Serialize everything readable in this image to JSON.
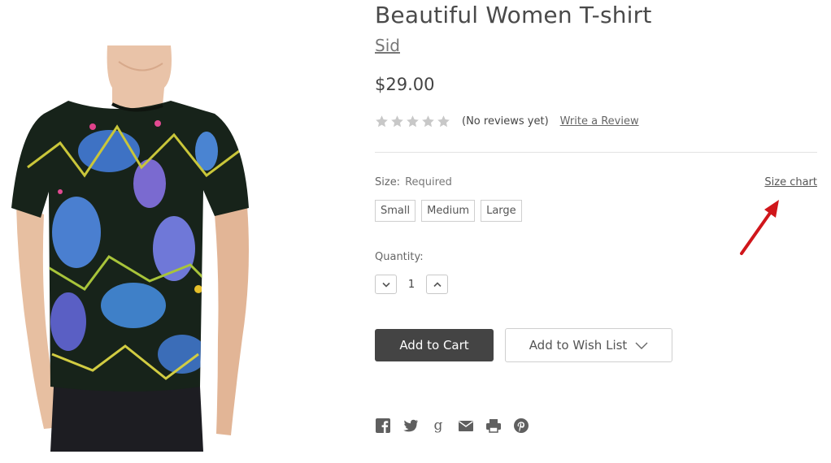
{
  "product": {
    "title": "Beautiful Women T-shirt",
    "brand": "Sid",
    "price": "$29.00",
    "image_icon": "t-shirt-photo",
    "rating_value": 0,
    "rating_max": 5,
    "reviews_text": "(No reviews yet)",
    "write_review": "Write a Review"
  },
  "options": {
    "size_label": "Size:",
    "size_required": "Required",
    "size_chart": "Size chart",
    "sizes": [
      "Small",
      "Medium",
      "Large"
    ]
  },
  "quantity": {
    "label": "Quantity:",
    "value": "1",
    "decrease_icon": "chevron-down-icon",
    "increase_icon": "chevron-up-icon"
  },
  "actions": {
    "add_to_cart": "Add to Cart",
    "wish_list": "Add to Wish List"
  },
  "social": [
    "facebook-icon",
    "twitter-icon",
    "google-icon",
    "email-icon",
    "print-icon",
    "pinterest-icon"
  ],
  "colors": {
    "button_dark": "#444444",
    "arrow_red": "#d0161b",
    "star_empty": "#c8c8c8"
  }
}
